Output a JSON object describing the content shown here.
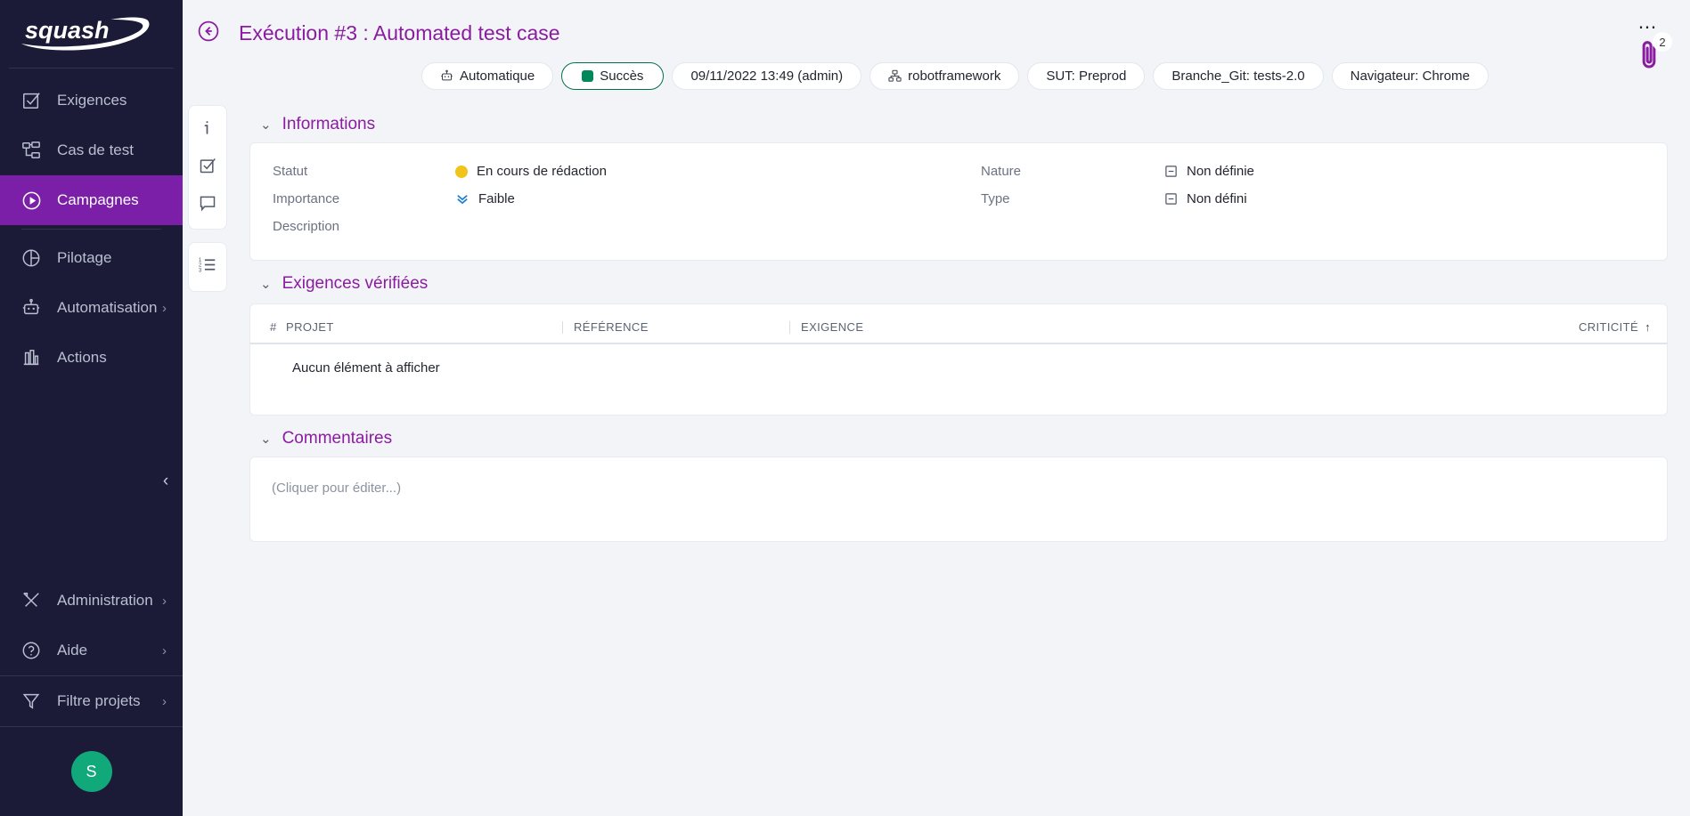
{
  "sidebar": {
    "logo_text": "squash",
    "items": [
      {
        "label": "Exigences",
        "icon": "checkbox-icon",
        "active": false,
        "chevron": false
      },
      {
        "label": "Cas de test",
        "icon": "sitemap-icon",
        "active": false,
        "chevron": false
      },
      {
        "label": "Campagnes",
        "icon": "play-circle-icon",
        "active": true,
        "chevron": false
      },
      {
        "label": "Pilotage",
        "icon": "pie-chart-icon",
        "active": false,
        "chevron": false
      },
      {
        "label": "Automatisation",
        "icon": "robot-icon",
        "active": false,
        "chevron": true
      },
      {
        "label": "Actions",
        "icon": "bar-chart-icon",
        "active": false,
        "chevron": false
      }
    ],
    "bottom_items": [
      {
        "label": "Administration",
        "icon": "tools-icon",
        "chevron": true
      },
      {
        "label": "Aide",
        "icon": "help-icon",
        "chevron": true
      }
    ],
    "filter_item": {
      "label": "Filtre projets",
      "icon": "funnel-icon",
      "chevron": true
    },
    "collapse_icon": "chevron-left-icon",
    "avatar_initial": "S"
  },
  "header": {
    "back_icon": "arrow-left-circle-icon",
    "title": "Exécution #3 : Automated test case",
    "more_icon": "ellipsis-icon",
    "attachment_icon": "paperclip-icon",
    "attachment_count": "2",
    "chips": [
      {
        "label": "Automatique",
        "icon": "robot-icon",
        "style": "plain"
      },
      {
        "label": "Succès",
        "icon": "green-square",
        "style": "success"
      },
      {
        "label": "09/11/2022 13:49 (admin)",
        "icon": "none",
        "style": "plain"
      },
      {
        "label": "robotframework",
        "icon": "sitemap-icon",
        "style": "plain"
      },
      {
        "label": "SUT: Preprod",
        "icon": "none",
        "style": "plain"
      },
      {
        "label": "Branche_Git: tests-2.0",
        "icon": "none",
        "style": "plain"
      },
      {
        "label": "Navigateur: Chrome",
        "icon": "none",
        "style": "plain"
      }
    ]
  },
  "icon_rail": {
    "group1": [
      {
        "icon": "info-icon",
        "name": "information-tab"
      },
      {
        "icon": "checkbox-icon",
        "name": "test-case-tab"
      },
      {
        "icon": "comment-icon",
        "name": "comments-tab"
      }
    ],
    "group2": [
      {
        "icon": "ordered-list-icon",
        "name": "steps-tab"
      }
    ]
  },
  "sections": {
    "informations": {
      "title": "Informations",
      "left": [
        {
          "label": "Statut",
          "value": "En cours de rédaction",
          "icon": "yellow-dot"
        },
        {
          "label": "Importance",
          "value": "Faible",
          "icon": "double-chevron-down-icon"
        },
        {
          "label": "Description",
          "value": "",
          "icon": "none"
        }
      ],
      "right": [
        {
          "label": "Nature",
          "value": "Non définie",
          "icon": "minus-square-icon"
        },
        {
          "label": "Type",
          "value": "Non défini",
          "icon": "minus-square-icon"
        }
      ]
    },
    "exigences": {
      "title": "Exigences vérifiées",
      "columns": [
        "#",
        "PROJET",
        "RÉFÉRENCE",
        "EXIGENCE",
        "CRITICITÉ"
      ],
      "sort_column": "CRITICITÉ",
      "sort_icon": "arrow-up-icon",
      "rows": [],
      "empty_message": "Aucun élément à afficher"
    },
    "commentaires": {
      "title": "Commentaires",
      "placeholder": "(Cliquer pour éditer...)"
    }
  },
  "colors": {
    "sidebar_bg": "#1b1b38",
    "accent_purple": "#8a1ca0",
    "active_nav": "#7b1fa8",
    "success_green": "#00704a",
    "status_yellow": "#f0c419",
    "importance_blue": "#1f7fd0",
    "avatar_green": "#11a87a",
    "page_bg": "#f2f4f8"
  }
}
